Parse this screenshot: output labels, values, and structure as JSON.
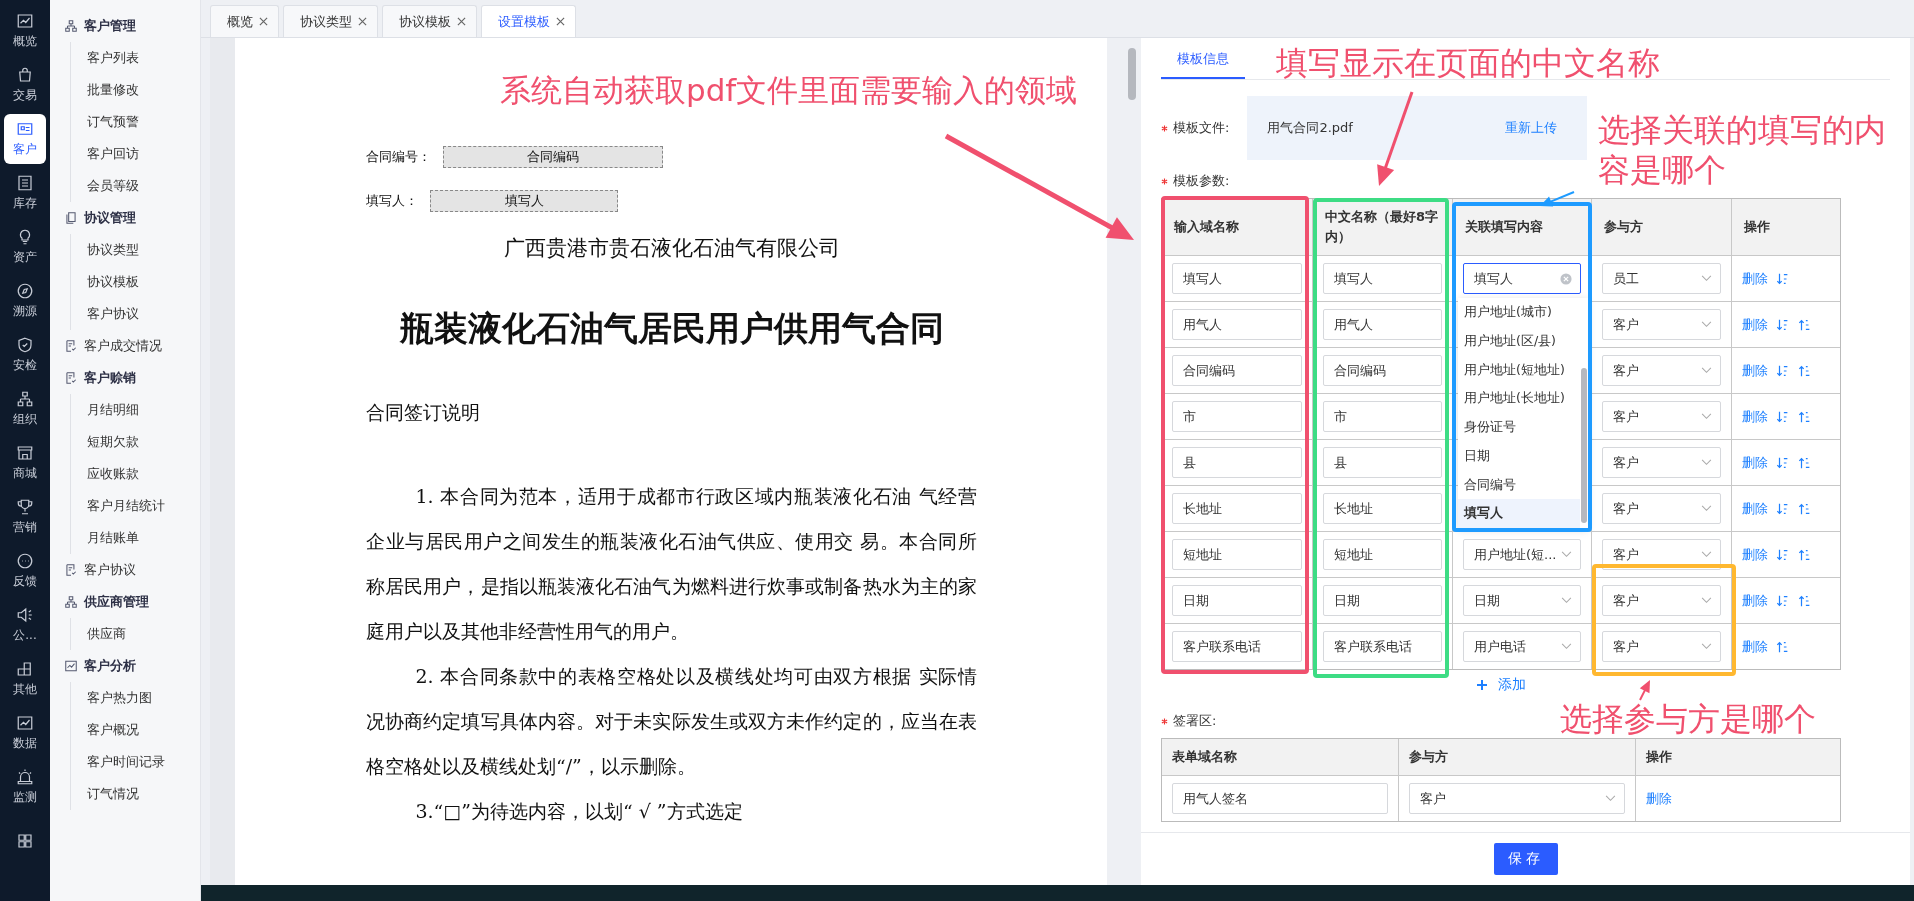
{
  "rail": [
    {
      "kind": "chart",
      "label": "概览",
      "selected": false
    },
    {
      "kind": "bag",
      "label": "交易",
      "selected": false
    },
    {
      "kind": "card",
      "label": "客户",
      "selected": true
    },
    {
      "kind": "list",
      "label": "库存",
      "selected": false
    },
    {
      "kind": "bulb",
      "label": "资产",
      "selected": false
    },
    {
      "kind": "compass",
      "label": "溯源",
      "selected": false
    },
    {
      "kind": "shield",
      "label": "安检",
      "selected": false
    },
    {
      "kind": "org",
      "label": "组织",
      "selected": false
    },
    {
      "kind": "store",
      "label": "商城",
      "selected": false
    },
    {
      "kind": "trophy",
      "label": "营销",
      "selected": false
    },
    {
      "kind": "chat",
      "label": "反馈",
      "selected": false
    },
    {
      "kind": "speaker",
      "label": "公...",
      "selected": false
    },
    {
      "kind": "blocks",
      "label": "其他",
      "selected": false
    },
    {
      "kind": "chart",
      "label": "数据",
      "selected": false
    },
    {
      "kind": "alarm",
      "label": "监测",
      "selected": false
    },
    {
      "kind": "grid",
      "selected": false
    }
  ],
  "sidebar": [
    {
      "kind": "org",
      "label": "客户管理",
      "children": [
        {
          "label": "客户列表"
        },
        {
          "label": "批量修改"
        },
        {
          "label": "订气预警"
        },
        {
          "label": "客户回访"
        },
        {
          "label": "会员等级"
        }
      ]
    },
    {
      "kind": "docs",
      "label": "协议管理",
      "children": [
        {
          "label": "协议类型"
        },
        {
          "label": "协议模板"
        },
        {
          "label": "客户协议"
        }
      ]
    },
    {
      "kind": "doccheck",
      "label": "客户成交情况"
    },
    {
      "kind": "doccheck",
      "label": "客户赊销",
      "children": [
        {
          "label": "月结明细"
        },
        {
          "label": "短期欠款"
        },
        {
          "label": "应收账款"
        },
        {
          "label": "客户月结统计"
        },
        {
          "label": "月结账单"
        }
      ]
    },
    {
      "kind": "doccheck",
      "label": "客户协议"
    },
    {
      "kind": "org",
      "label": "供应商管理",
      "children": [
        {
          "label": "供应商"
        }
      ]
    },
    {
      "kind": "chart",
      "label": "客户分析",
      "children": [
        {
          "label": "客户热力图"
        },
        {
          "label": "客户概况"
        },
        {
          "label": "客户时间记录"
        },
        {
          "label": "订气情况"
        }
      ]
    }
  ],
  "tabs": [
    {
      "label": "概览",
      "selected": false
    },
    {
      "label": "协议类型",
      "selected": false
    },
    {
      "label": "协议模板",
      "selected": false
    },
    {
      "label": "设置模板",
      "selected": true
    }
  ],
  "pdf": {
    "fields": [
      {
        "label": "合同编号：",
        "value": "合同编码"
      },
      {
        "label": "填写人：",
        "value": "填写人"
      }
    ],
    "company": "广西贵港市贵石液化石油气有限公司",
    "title": "瓶装液化石油气居民用户供用气合同",
    "section": "合同签订说明",
    "paragraphs": [
      "1.  本合同为范本，适用于成都市行政区域内瓶装液化石油 气经营企业与居民用户之间发生的瓶装液化石油气供应、使用交 易。本合同所称居民用户，是指以瓶装液化石油气为燃料进行炊事或制备热水为主的家庭用户以及其他非经营性用气的用户。",
      "2.  本合同条款中的表格空格处以及横线处均可由双方根据 实际情况协商约定填写具体内容。对于未实际发生或双方未作约定的，应当在表格空格处以及横线处划“/”，以示删除。",
      "3.“□”为待选内容，以划“ √ ”方式选定"
    ]
  },
  "panel": {
    "tabs": [
      {
        "label": "模板信息",
        "selected": true
      }
    ],
    "file": {
      "label": "模板文件:",
      "required": true,
      "name": "用气合同2.pdf",
      "action": "重新上传"
    },
    "params": {
      "label": "模板参数:",
      "required": true,
      "columns": [
        "输入域名称",
        "中文名称（最好8字内）",
        "关联填写内容",
        "参与方",
        "操作"
      ],
      "rows": [
        {
          "field": "填写人",
          "name": "填写人",
          "related": "填写人",
          "focused": true,
          "party": "员工",
          "action": "删除",
          "move_down": true,
          "move_up": false
        },
        {
          "field": "用气人",
          "name": "用气人",
          "party": "客户",
          "action": "删除",
          "move_down": true,
          "move_up": true
        },
        {
          "field": "合同编码",
          "name": "合同编码",
          "party": "客户",
          "action": "删除",
          "move_down": true,
          "move_up": true
        },
        {
          "field": "市",
          "name": "市",
          "party": "客户",
          "action": "删除",
          "move_down": true,
          "move_up": true
        },
        {
          "field": "县",
          "name": "县",
          "party": "客户",
          "action": "删除",
          "move_down": true,
          "move_up": true
        },
        {
          "field": "长地址",
          "name": "长地址",
          "party": "客户",
          "action": "删除",
          "move_down": true,
          "move_up": true
        },
        {
          "field": "短地址",
          "name": "短地址",
          "related": "用户地址(短...",
          "focused": false,
          "party": "客户",
          "action": "删除",
          "move_down": true,
          "move_up": true
        },
        {
          "field": "日期",
          "name": "日期",
          "related": "日期",
          "focused": false,
          "party": "客户",
          "action": "删除",
          "move_down": true,
          "move_up": true
        },
        {
          "field": "客户联系电话",
          "name": "客户联系电话",
          "related": "用户电话",
          "focused": false,
          "party": "客户",
          "action": "删除",
          "move_down": false,
          "move_up": true
        }
      ],
      "dropdown": {
        "options": [
          {
            "label": "用户地址(城市)",
            "selected": false
          },
          {
            "label": "用户地址(区/县)",
            "selected": false
          },
          {
            "label": "用户地址(短地址)",
            "selected": false
          },
          {
            "label": "用户地址(长地址)",
            "selected": false
          },
          {
            "label": "身份证号",
            "selected": false
          },
          {
            "label": "日期",
            "selected": false
          },
          {
            "label": "合同编号",
            "selected": false
          },
          {
            "label": "填写人",
            "selected": true
          }
        ]
      },
      "add": "添加"
    },
    "signature": {
      "label": "签署区:",
      "required": true,
      "columns": [
        "表单域名称",
        "参与方",
        "操作"
      ],
      "rows": [
        {
          "field": "用气人签名",
          "party": "客户",
          "action": "删除"
        }
      ]
    },
    "save": "保存"
  },
  "annotations": [
    {
      "text": "系统自动获取pdf文件里面需要输入的领域"
    },
    {
      "text": "填写显示在页面的中文名称"
    },
    {
      "text": "选择关联的填写的内容是哪个"
    },
    {
      "text": "选择参与方是哪个"
    }
  ]
}
